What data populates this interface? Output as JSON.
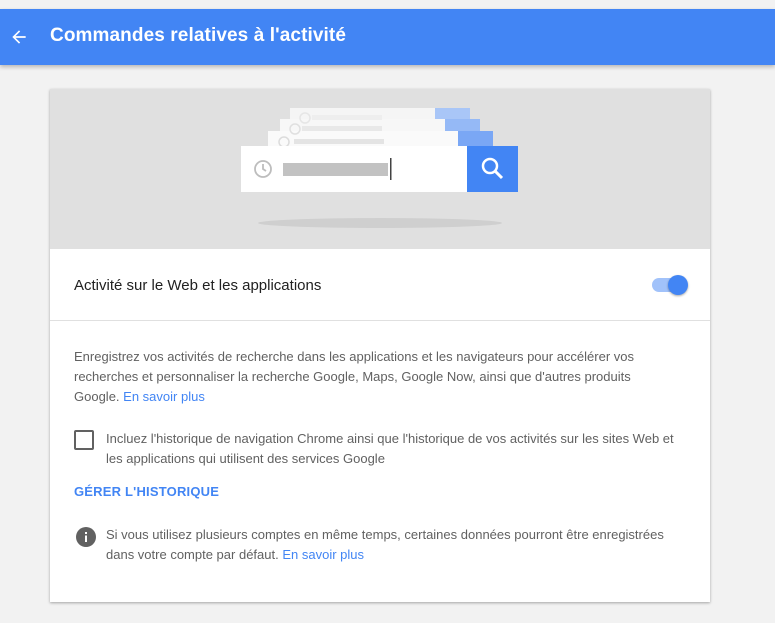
{
  "header": {
    "back_icon": "arrow-left-icon",
    "title": "Commandes relatives à l'activité",
    "color": "#4285f4"
  },
  "setting": {
    "title": "Activité sur le Web et les applications",
    "toggle_on": true
  },
  "description": {
    "text": "Enregistrez vos activités de recherche dans les applications et les navigateurs pour accélérer vos recherches et personnaliser la recherche Google, Maps, Google Now, ainsi que d'autres produits Google.",
    "link": "En savoir plus"
  },
  "chrome_history": {
    "checked": false,
    "label": "Incluez l'historique de navigation Chrome ainsi que l'historique de vos activités sur les sites Web et les applications qui utilisent des services Google"
  },
  "manage_button": "GÉRER L'HISTORIQUE",
  "info": {
    "icon": "info-icon",
    "text": "Si vous utilisez plusieurs comptes en même temps, certaines données pourront être enregistrées dans votre compte par défaut.",
    "link": "En savoir plus"
  }
}
